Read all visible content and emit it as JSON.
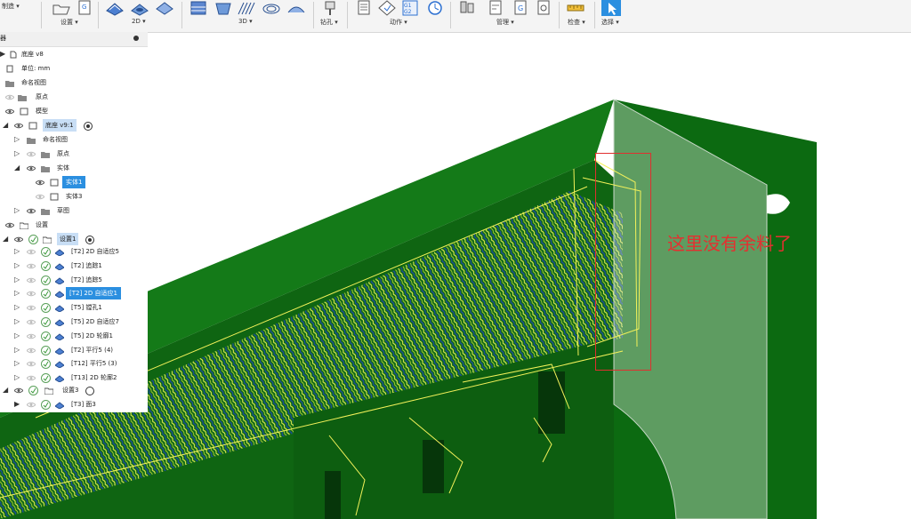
{
  "toolbar": {
    "manufacture_label": "制造 ▾",
    "groups": {
      "setup": "设置 ▾",
      "d2": "2D ▾",
      "d3": "3D ▾",
      "drilling": "钻孔 ▾",
      "actions": "动作 ▾",
      "manage": "管理 ▾",
      "inspect": "检查 ▾",
      "select": "选择 ▾"
    },
    "g1g2_label": "G1 G2"
  },
  "browser": {
    "header_title": "器",
    "rows": [
      {
        "label": "底座 v8"
      },
      {
        "label": "单位: mm"
      },
      {
        "label": "命名视图"
      },
      {
        "label": "原点"
      },
      {
        "label": "模型"
      },
      {
        "label": "底座 v9:1"
      },
      {
        "label": "命名视图"
      },
      {
        "label": "原点"
      },
      {
        "label": "实体"
      },
      {
        "label": "实体1"
      },
      {
        "label": "实体3"
      },
      {
        "label": "草图"
      },
      {
        "label": "设置"
      },
      {
        "label": "设置1"
      },
      {
        "label": "[T2] 2D 自适应5"
      },
      {
        "label": "[T2] 追踪1"
      },
      {
        "label": "[T2] 追踪5"
      },
      {
        "label": "[T2] 2D 自适应1"
      },
      {
        "label": "[T5] 镗孔1"
      },
      {
        "label": "[T5] 2D 自适应7"
      },
      {
        "label": "[T5] 2D 轮廓1"
      },
      {
        "label": "[T2] 平行5 (4)"
      },
      {
        "label": "[T12] 平行5 (3)"
      },
      {
        "label": "[T13] 2D 轮廓2"
      },
      {
        "label": "设置3"
      },
      {
        "label": "[T3] 面3"
      }
    ]
  },
  "annotation": {
    "text": "这里没有余料了",
    "color": "#e43030"
  },
  "colors": {
    "stock_green": "#0e6e12",
    "highlight_blue": "#2b8fe0",
    "toolpath_yellow": "#f3f25a",
    "toolpath_blue": "#1f3fbf"
  }
}
